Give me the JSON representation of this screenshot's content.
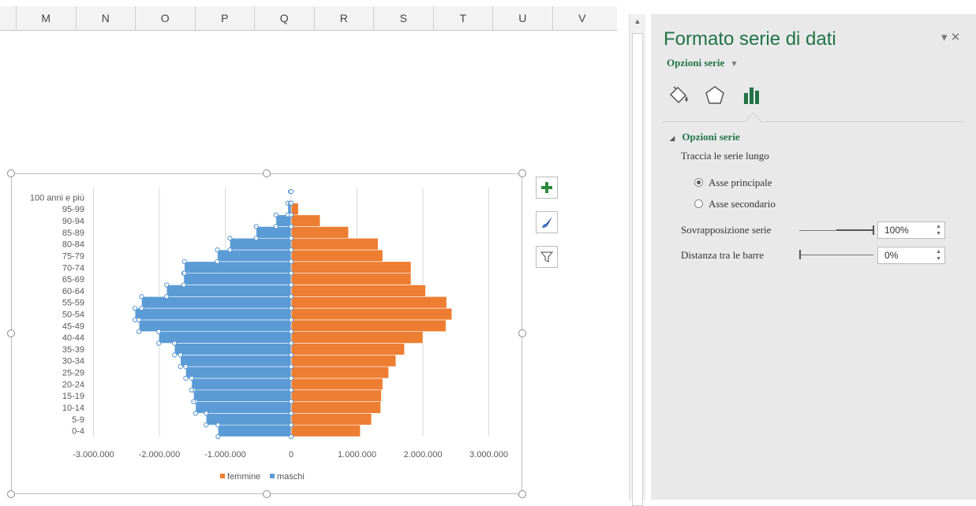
{
  "sheet": {
    "columns": [
      "M",
      "N",
      "O",
      "P",
      "Q",
      "R",
      "S",
      "T",
      "U",
      "V"
    ]
  },
  "chart_side_buttons": [
    {
      "name": "chart-elements-button",
      "icon": "plus-icon"
    },
    {
      "name": "chart-styles-button",
      "icon": "brush-icon"
    },
    {
      "name": "chart-filters-button",
      "icon": "funnel-icon"
    }
  ],
  "chart_data": {
    "type": "bar",
    "orientation": "horizontal",
    "categories": [
      "0-4",
      "5-9",
      "10-14",
      "15-19",
      "20-24",
      "25-29",
      "30-34",
      "35-39",
      "40-44",
      "45-49",
      "50-54",
      "55-59",
      "60-64",
      "65-69",
      "70-74",
      "75-79",
      "80-84",
      "85-89",
      "90-94",
      "95-99",
      "100 anni e più"
    ],
    "series": [
      {
        "name": "femmine",
        "color": "#ED7D31",
        "values": [
          1050000,
          1220000,
          1360000,
          1370000,
          1390000,
          1480000,
          1590000,
          1720000,
          2000000,
          2350000,
          2440000,
          2360000,
          2040000,
          1820000,
          1820000,
          1390000,
          1320000,
          870000,
          440000,
          110000,
          10000
        ]
      },
      {
        "name": "maschi",
        "color": "#5B9BD5",
        "values": [
          -1110000,
          -1290000,
          -1450000,
          -1480000,
          -1510000,
          -1600000,
          -1680000,
          -1770000,
          -2010000,
          -2310000,
          -2370000,
          -2270000,
          -1890000,
          -1630000,
          -1620000,
          -1120000,
          -930000,
          -530000,
          -230000,
          -50000,
          -10000
        ]
      }
    ],
    "x_ticks": [
      "-3.000.000",
      "-2.000.000",
      "-1.000.000",
      "0",
      "1.000.000",
      "2.000.000",
      "3.000.000"
    ],
    "xlim": [
      -3000000,
      3000000
    ],
    "grid": "vertical",
    "legend": {
      "position": "bottom",
      "entries": [
        "femmine",
        "maschi"
      ]
    },
    "selected_series": "maschi"
  },
  "pane": {
    "title": "Formato serie di dati",
    "subtitle": "Opzioni serie",
    "subtitle_arrow": "▼",
    "controls": "▾ ✕",
    "icons": [
      "fill-line-icon",
      "effects-icon",
      "series-options-icon"
    ],
    "section_title": "Opzioni serie",
    "section_arrow": "◢",
    "plot_on_label": "Traccia le serie lungo",
    "radio_primary": "Asse principale",
    "radio_secondary": "Asse secondario",
    "overlap_label": "Sovrapposizione serie",
    "overlap_value": "100%",
    "gap_label": "Distanza tra le barre",
    "gap_value": "0%"
  },
  "colors": {
    "accent": "#217346",
    "female": "#ED7D31",
    "male": "#5B9BD5"
  }
}
